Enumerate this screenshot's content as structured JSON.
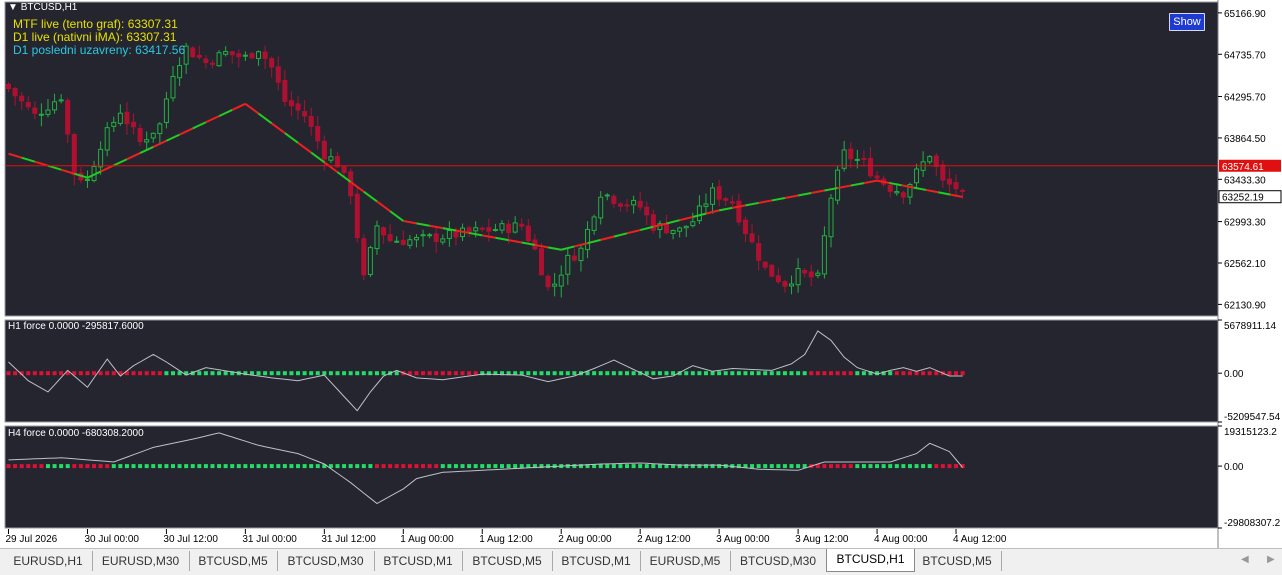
{
  "symbol_title": "BTCUSD,H1",
  "info_lines": [
    {
      "text": "MTF live (tento graf): 63307.31",
      "color": "#e6e000"
    },
    {
      "text": "D1 live (nativni iMA): 63307.31",
      "color": "#e6e000"
    },
    {
      "text": "D1 posledni uzavreny: 63417.56",
      "color": "#28c8e0"
    }
  ],
  "show_button": "Show",
  "chart_data": [
    {
      "type": "candlestick",
      "title": "BTCUSD,H1",
      "y_ticks": [
        "65166.90",
        "64735.70",
        "64295.70",
        "63864.50",
        "63433.30",
        "62993.30",
        "62562.10",
        "62130.90"
      ],
      "y_tick_values": [
        65166.9,
        64735.7,
        64295.7,
        63864.5,
        63433.3,
        62993.3,
        62562.1,
        62130.9
      ],
      "ylim": [
        62010,
        65280
      ],
      "price_line": {
        "value": 63574.61,
        "label": "63574.61",
        "color": "#e01010"
      },
      "last_price": {
        "value": 63252.19,
        "label": "63252.19"
      },
      "x_labels": [
        "29 Jul 2026",
        "30 Jul 00:00",
        "30 Jul 12:00",
        "31 Jul 00:00",
        "31 Jul 12:00",
        "1 Aug 00:00",
        "1 Aug 12:00",
        "2 Aug 00:00",
        "2 Aug 12:00",
        "3 Aug 00:00",
        "3 Aug 12:00",
        "4 Aug 00:00",
        "4 Aug 12:00"
      ],
      "x_label_bars": [
        0,
        12,
        24,
        36,
        48,
        60,
        72,
        84,
        96,
        108,
        120,
        132,
        144
      ],
      "candle_count": 146,
      "close_anchors": [
        [
          0,
          64380
        ],
        [
          4,
          64100
        ],
        [
          8,
          64300
        ],
        [
          10,
          63500
        ],
        [
          12,
          63420
        ],
        [
          14,
          63800
        ],
        [
          17,
          64150
        ],
        [
          20,
          63820
        ],
        [
          23,
          64000
        ],
        [
          25,
          64550
        ],
        [
          27,
          64800
        ],
        [
          30,
          64650
        ],
        [
          33,
          64750
        ],
        [
          36,
          64700
        ],
        [
          38,
          64800
        ],
        [
          40,
          64600
        ],
        [
          42,
          64250
        ],
        [
          45,
          64100
        ],
        [
          48,
          63700
        ],
        [
          50,
          63600
        ],
        [
          52,
          63300
        ],
        [
          54,
          62400
        ],
        [
          56,
          62950
        ],
        [
          58,
          62800
        ],
        [
          62,
          62800
        ],
        [
          67,
          62850
        ],
        [
          72,
          62900
        ],
        [
          78,
          62950
        ],
        [
          80,
          62700
        ],
        [
          82,
          62300
        ],
        [
          83,
          62350
        ],
        [
          85,
          62600
        ],
        [
          87,
          62700
        ],
        [
          90,
          63300
        ],
        [
          93,
          63200
        ],
        [
          96,
          63150
        ],
        [
          98,
          62950
        ],
        [
          102,
          62900
        ],
        [
          104,
          63000
        ],
        [
          107,
          63300
        ],
        [
          110,
          63200
        ],
        [
          112,
          62900
        ],
        [
          115,
          62500
        ],
        [
          118,
          62350
        ],
        [
          120,
          62450
        ],
        [
          123,
          62400
        ],
        [
          125,
          63250
        ],
        [
          127,
          63700
        ],
        [
          130,
          63600
        ],
        [
          132,
          63450
        ],
        [
          134,
          63350
        ],
        [
          136,
          63300
        ],
        [
          138,
          63500
        ],
        [
          140,
          63700
        ],
        [
          142,
          63400
        ],
        [
          144,
          63350
        ],
        [
          145,
          63252
        ]
      ],
      "ma_points": [
        [
          0,
          63700
        ],
        [
          12,
          63450
        ],
        [
          36,
          64220
        ],
        [
          60,
          63000
        ],
        [
          84,
          62700
        ],
        [
          108,
          63110
        ],
        [
          132,
          63420
        ],
        [
          145,
          63250
        ]
      ],
      "ma_colors": {
        "up": "#22cc22",
        "down": "#ee2020"
      }
    },
    {
      "type": "line",
      "title": "H1 force  0.0000 -295817.6000",
      "y_ticks": [
        "5678911.14",
        "0.00",
        "-5209547.54"
      ],
      "y_tick_values": [
        5678911.14,
        0,
        -5209547.54
      ],
      "ylim": [
        -5209547.54,
        5678911.14
      ],
      "zero_colors": {
        "positive": "#22dd66",
        "negative": "#dd1133"
      },
      "anchors": [
        [
          0,
          1200000
        ],
        [
          3,
          -800000
        ],
        [
          6,
          -2000000
        ],
        [
          9,
          300000
        ],
        [
          12,
          -1500000
        ],
        [
          15,
          1500000
        ],
        [
          17,
          -300000
        ],
        [
          19,
          800000
        ],
        [
          22,
          2000000
        ],
        [
          24,
          1200000
        ],
        [
          27,
          -200000
        ],
        [
          30,
          600000
        ],
        [
          36,
          -100000
        ],
        [
          40,
          -500000
        ],
        [
          44,
          -800000
        ],
        [
          48,
          -200000
        ],
        [
          51,
          -2500000
        ],
        [
          53,
          -4000000
        ],
        [
          55,
          -2000000
        ],
        [
          57,
          -300000
        ],
        [
          59,
          300000
        ],
        [
          62,
          -500000
        ],
        [
          66,
          -700000
        ],
        [
          72,
          -100000
        ],
        [
          78,
          -200000
        ],
        [
          82,
          -900000
        ],
        [
          86,
          -300000
        ],
        [
          89,
          500000
        ],
        [
          92,
          1400000
        ],
        [
          95,
          400000
        ],
        [
          98,
          -600000
        ],
        [
          101,
          -300000
        ],
        [
          104,
          800000
        ],
        [
          107,
          200000
        ],
        [
          110,
          500000
        ],
        [
          113,
          400000
        ],
        [
          116,
          300000
        ],
        [
          119,
          1000000
        ],
        [
          121,
          2000000
        ],
        [
          123,
          4500000
        ],
        [
          125,
          3500000
        ],
        [
          127,
          1700000
        ],
        [
          129,
          600000
        ],
        [
          132,
          -100000
        ],
        [
          134,
          300000
        ],
        [
          136,
          600000
        ],
        [
          138,
          200000
        ],
        [
          140,
          600000
        ],
        [
          143,
          -300000
        ],
        [
          145,
          -296000
        ]
      ],
      "zero_sign": [
        [
          0,
          23,
          -1
        ],
        [
          24,
          59,
          1
        ],
        [
          60,
          71,
          -1
        ],
        [
          72,
          121,
          1
        ],
        [
          122,
          128,
          -1
        ],
        [
          129,
          134,
          1
        ],
        [
          135,
          145,
          -1
        ]
      ]
    },
    {
      "type": "line",
      "title": "H4 force  0.0000 -680308.2000",
      "y_ticks": [
        "19315123.2",
        "0.00",
        "-29808307.2"
      ],
      "y_tick_values": [
        19315123.2,
        0,
        -29808307.2
      ],
      "ylim": [
        -29808307.2,
        19315123.2
      ],
      "zero_colors": {
        "positive": "#22dd66",
        "negative": "#dd1133"
      },
      "anchors": [
        [
          0,
          3000000
        ],
        [
          8,
          4000000
        ],
        [
          16,
          2000000
        ],
        [
          22,
          9000000
        ],
        [
          28,
          13000000
        ],
        [
          32,
          16000000
        ],
        [
          38,
          10000000
        ],
        [
          44,
          6000000
        ],
        [
          48,
          1000000
        ],
        [
          52,
          -8000000
        ],
        [
          56,
          -18000000
        ],
        [
          60,
          -11000000
        ],
        [
          62,
          -6000000
        ],
        [
          66,
          -3000000
        ],
        [
          72,
          -2000000
        ],
        [
          78,
          -1000000
        ],
        [
          84,
          0
        ],
        [
          90,
          1000000
        ],
        [
          96,
          1500000
        ],
        [
          102,
          500000
        ],
        [
          108,
          500000
        ],
        [
          114,
          -1500000
        ],
        [
          120,
          -2000000
        ],
        [
          124,
          2000000
        ],
        [
          130,
          2000000
        ],
        [
          134,
          2000000
        ],
        [
          138,
          6000000
        ],
        [
          140,
          11000000
        ],
        [
          143,
          7000000
        ],
        [
          145,
          -680000
        ]
      ],
      "zero_sign": [
        [
          0,
          5,
          -1
        ],
        [
          6,
          9,
          1
        ],
        [
          10,
          15,
          -1
        ],
        [
          16,
          55,
          1
        ],
        [
          56,
          65,
          -1
        ],
        [
          66,
          121,
          1
        ],
        [
          122,
          128,
          -1
        ],
        [
          129,
          140,
          1
        ],
        [
          141,
          145,
          -1
        ]
      ]
    }
  ],
  "tabs": [
    "EURUSD,H1",
    "EURUSD,M30",
    "BTCUSD,M5",
    "BTCUSD,M30",
    "BTCUSD,M1",
    "BTCUSD,M5",
    "BTCUSD,M1",
    "EURUSD,M5",
    "BTCUSD,M30",
    "BTCUSD,H1",
    "BTCUSD,M5"
  ],
  "active_tab": "BTCUSD,H1",
  "colors": {
    "chart_bg": "#252530",
    "candle_up": "#20b040",
    "candle_down": "#b01030",
    "grid": "#7a7a88",
    "axis_text": "#000000"
  }
}
